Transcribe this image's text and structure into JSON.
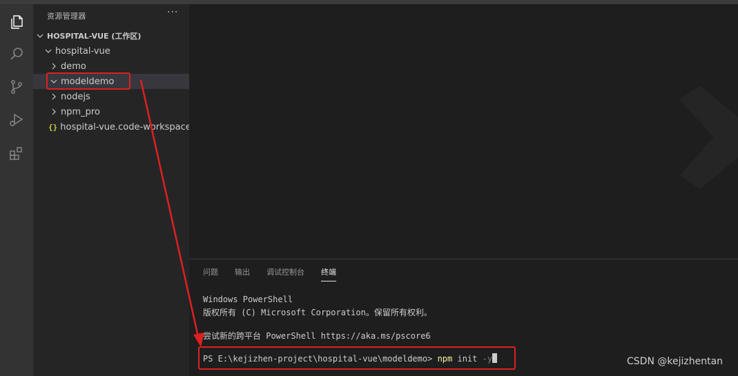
{
  "activitybar": {
    "icons": [
      "explorer-icon",
      "search-icon",
      "source-control-icon",
      "run-debug-icon",
      "extensions-icon"
    ]
  },
  "sidebar": {
    "title": "资源管理器",
    "more": "···",
    "workspace": "HOSPITAL-VUE (工作区)",
    "tree": [
      {
        "label": "hospital-vue",
        "type": "folder-open"
      },
      {
        "label": "demo",
        "type": "folder-closed"
      },
      {
        "label": "modeldemo",
        "type": "folder-open",
        "selected": true
      },
      {
        "label": "nodejs",
        "type": "folder-closed"
      },
      {
        "label": "npm_pro",
        "type": "folder-closed"
      },
      {
        "label": "hospital-vue.code-workspace",
        "type": "file-json",
        "icon_text": "{}"
      }
    ]
  },
  "panel": {
    "tabs": [
      "问题",
      "输出",
      "调试控制台",
      "终端"
    ],
    "active_tab": "终端",
    "terminal": {
      "line1": "Windows PowerShell",
      "line2": "版权所有 (C) Microsoft Corporation。保留所有权利。",
      "line3": "尝试新的跨平台 PowerShell https://aka.ms/pscore6",
      "prompt": "PS E:\\kejizhen-project\\hospital-vue\\modeldemo> ",
      "cmd": "npm",
      "arg": " init ",
      "flag": "-y"
    }
  },
  "watermark_text": "CSDN @kejizhentan",
  "colors": {
    "highlight": "#e02020",
    "accent_npm": "#f9f1a5",
    "json_icon": "#cbcb41"
  }
}
